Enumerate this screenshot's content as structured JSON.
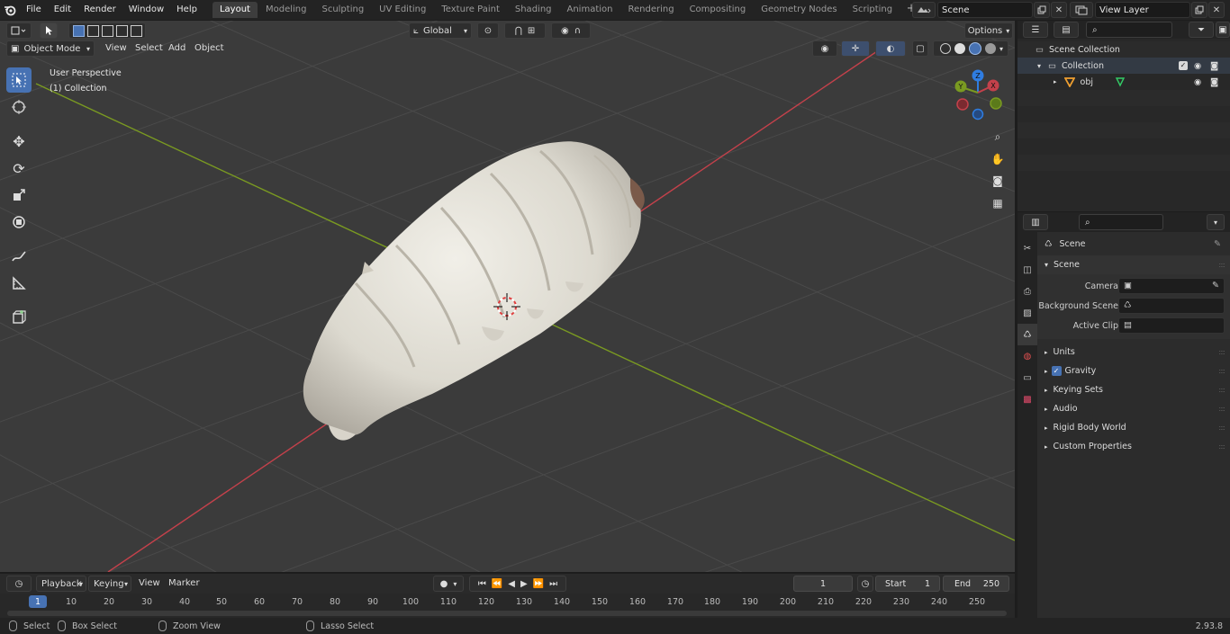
{
  "top_menu": {
    "items": [
      "File",
      "Edit",
      "Render",
      "Window",
      "Help"
    ]
  },
  "workspaces": {
    "tabs": [
      "Layout",
      "Modeling",
      "Sculpting",
      "UV Editing",
      "Texture Paint",
      "Shading",
      "Animation",
      "Rendering",
      "Compositing",
      "Geometry Nodes",
      "Scripting"
    ],
    "active": "Layout",
    "add_label": "+"
  },
  "scene": {
    "name": "Scene"
  },
  "view_layer": {
    "name": "View Layer"
  },
  "viewport": {
    "mode": "Object Mode",
    "menus": [
      "View",
      "Select",
      "Add",
      "Object"
    ],
    "transform_orientation": "Global",
    "options_label": "Options",
    "overlay_title": "User Perspective",
    "overlay_collection": "(1) Collection",
    "gizmo_axes": [
      "X",
      "Y",
      "Z"
    ]
  },
  "outliner": {
    "search_placeholder": "",
    "rows": [
      {
        "label": "Scene Collection",
        "type": "scene-collection"
      },
      {
        "label": "Collection",
        "type": "collection"
      },
      {
        "label": "obj",
        "type": "mesh"
      }
    ]
  },
  "properties": {
    "context_title": "Scene",
    "panel_title": "Scene",
    "fields": [
      {
        "label": "Camera",
        "value": ""
      },
      {
        "label": "Background Scene",
        "value": ""
      },
      {
        "label": "Active Clip",
        "value": ""
      }
    ],
    "panels": [
      "Units",
      "Gravity",
      "Keying Sets",
      "Audio",
      "Rigid Body World",
      "Custom Properties"
    ],
    "gravity_checked": true
  },
  "timeline": {
    "menus": [
      "Playback",
      "Keying",
      "View",
      "Marker"
    ],
    "current_frame": "1",
    "start_label": "Start",
    "start_value": "1",
    "end_label": "End",
    "end_value": "250",
    "ruler_ticks": [
      "1",
      "10",
      "20",
      "30",
      "40",
      "50",
      "60",
      "70",
      "80",
      "90",
      "100",
      "110",
      "120",
      "130",
      "140",
      "150",
      "160",
      "170",
      "180",
      "190",
      "200",
      "210",
      "220",
      "230",
      "240",
      "250"
    ]
  },
  "statusbar": {
    "items": [
      "Select",
      "Box Select",
      "Zoom View",
      "Lasso Select"
    ],
    "version": "2.93.8"
  },
  "colors": {
    "accent": "#4772b3",
    "x_axis": "#c4414b",
    "y_axis": "#7a9a21",
    "z_axis": "#2f7de1"
  }
}
